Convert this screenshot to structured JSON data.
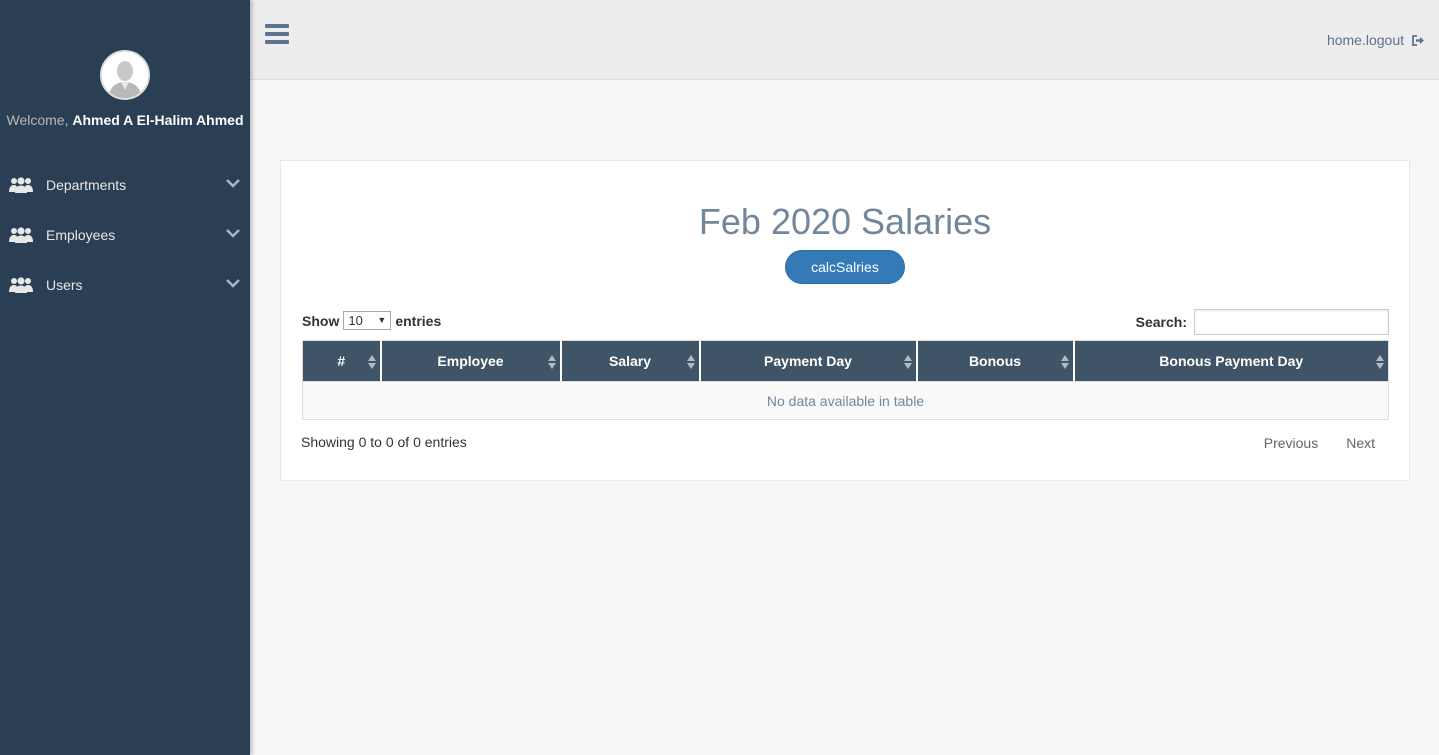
{
  "sidebar": {
    "welcome_prefix": "Welcome,",
    "user_name": "Ahmed A El-Halim Ahmed",
    "items": [
      {
        "label": "Departments",
        "icon": "users-icon"
      },
      {
        "label": "Employees",
        "icon": "users-icon"
      },
      {
        "label": "Users",
        "icon": "users-icon"
      }
    ]
  },
  "topbar": {
    "logout_label": "home.logout"
  },
  "main": {
    "title": "Feb 2020 Salaries",
    "calc_button": "calcSalries",
    "length": {
      "prefix": "Show",
      "value": "10",
      "suffix": "entries"
    },
    "search": {
      "label": "Search:",
      "value": ""
    },
    "table": {
      "columns": [
        "#",
        "Employee",
        "Salary",
        "Payment Day",
        "Bonous",
        "Bonous Payment Day"
      ],
      "empty_message": "No data available in table"
    },
    "info": "Showing 0 to 0 of 0 entries",
    "pager": {
      "previous": "Previous",
      "next": "Next"
    }
  },
  "colors": {
    "sidebar_bg": "#2a3f54",
    "header_bg": "#405467",
    "accent": "#337ab7",
    "title": "#73879c"
  }
}
